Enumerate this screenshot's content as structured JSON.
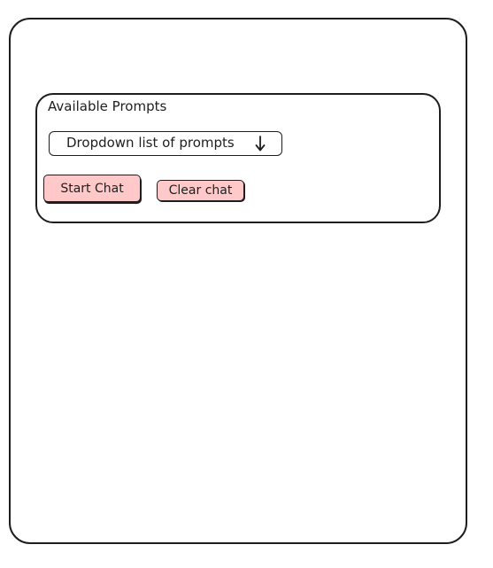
{
  "panel": {
    "title": "Available Prompts",
    "dropdown": {
      "selected_label": "Dropdown list of prompts",
      "icon": "arrow-down-icon"
    },
    "buttons": {
      "start_label": "Start Chat",
      "clear_label": "Clear chat"
    }
  },
  "colors": {
    "stroke": "#1e1e1e",
    "button_fill": "#ffc9c9",
    "background": "#ffffff"
  }
}
